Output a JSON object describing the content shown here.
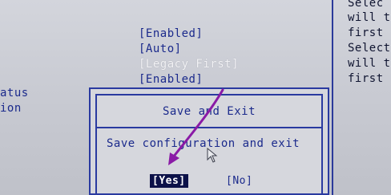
{
  "main": {
    "values": [
      "[Enabled]",
      "[Auto]",
      "[Legacy First]",
      "[Enabled]"
    ],
    "left_labels": [
      "atus",
      "ion"
    ]
  },
  "help_panel": {
    "lines": [
      "Selec",
      "will t",
      "first",
      "Selecti",
      "will t",
      "first a"
    ]
  },
  "dialog": {
    "title": "Save and Exit",
    "message": "Save configuration and exit",
    "yes_label": "[Yes]",
    "no_label": "[No]"
  },
  "colors": {
    "text_blue": "#1b2a8c",
    "border_blue": "#2a3aa0",
    "selected_bg": "#0c1148",
    "annotation_arrow": "#8a1aa6"
  },
  "icons": {
    "cursor": "mouse-pointer-icon",
    "annotation": "arrow-annotation"
  }
}
